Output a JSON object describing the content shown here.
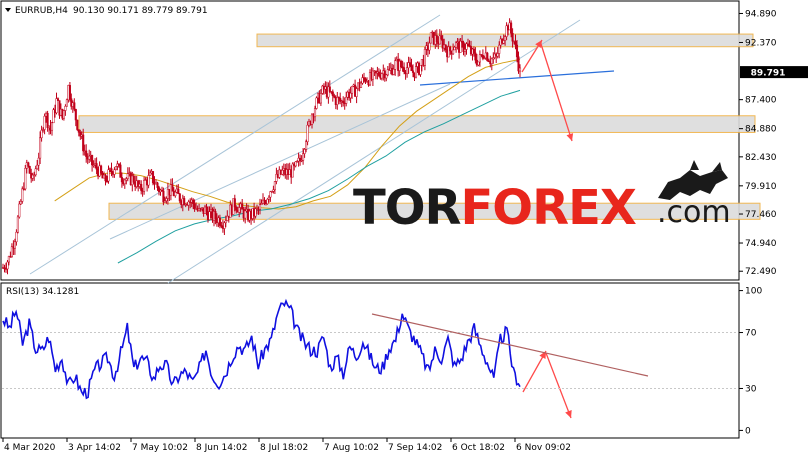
{
  "header": {
    "symbol_label": "EURRUB,H4",
    "ohlc_text": "90.130 90.171 89.779 89.791",
    "collapse_icon": "triangle-down-icon"
  },
  "rsi_header": {
    "label": "RSI(13) 34.1281"
  },
  "watermark": {
    "part1": "TOR",
    "part2": "FOREX",
    "part3": ".com",
    "logo_icon": "bull-bear-icon"
  },
  "colors": {
    "candle": "#c0001a",
    "ma_fast": "#d4a017",
    "ma_slow": "#20a0a0",
    "channel": "#a8c4d8",
    "trend_blue": "#2a6fdb",
    "arrow": "#ff4a4a",
    "zone_fill": "#dcdcdc",
    "zone_border": "#f0b040",
    "rsi_line": "#1010e0",
    "rsi_trend": "#b06060",
    "price_tag_bg": "#000000",
    "price_tag_fg": "#ffffff",
    "watermark_dark": "#1a1a1a",
    "watermark_red": "#e8261c"
  },
  "chart_data": [
    {
      "type": "candlestick",
      "title": "EURRUB,H4",
      "x_labels": [
        "4 Mar 2020",
        "3 Apr 14:02",
        "7 May 10:02",
        "8 Jun 14:02",
        "8 Jul 18:02",
        "7 Aug 10:02",
        "7 Sep 14:02",
        "6 Oct 18:02",
        "6 Nov 09:02"
      ],
      "y_ticks": [
        "94.890",
        "92.370",
        "89.791",
        "87.400",
        "84.880",
        "82.430",
        "79.910",
        "77.460",
        "74.940",
        "72.490"
      ],
      "y_tick_values": [
        94.89,
        92.37,
        89.791,
        87.4,
        84.88,
        82.43,
        79.91,
        77.46,
        74.94,
        72.49
      ],
      "ylim": [
        71.9,
        95.8
      ],
      "current_price": "89.791",
      "close_series": [
        72.8,
        73.6,
        75.5,
        78.5,
        81.8,
        80.3,
        82.6,
        86.3,
        84.8,
        87.3,
        85.8,
        88.5,
        86.3,
        84.3,
        82.5,
        81.8,
        81.3,
        80.3,
        81.0,
        81.8,
        80.7,
        80.5,
        80.5,
        79.5,
        80.3,
        80.7,
        79.8,
        79.1,
        79.5,
        79.2,
        78.8,
        78.7,
        78.4,
        77.6,
        77.8,
        77.3,
        77.1,
        76.8,
        77.6,
        78.4,
        77.8,
        77.3,
        77.4,
        77.8,
        78.5,
        79.6,
        80.5,
        81.1,
        81.0,
        81.3,
        82.1,
        84.2,
        86.2,
        87.4,
        88.3,
        87.9,
        87.4,
        87.2,
        87.9,
        88.1,
        88.7,
        89.3,
        89.2,
        89.6,
        89.9,
        89.8,
        90.5,
        90.3,
        90.2,
        89.8,
        90.1,
        91.2,
        92.8,
        92.6,
        92.3,
        91.5,
        92.2,
        91.9,
        92.1,
        91.3,
        90.7,
        91.6,
        90.9,
        91.0,
        92.8,
        93.9,
        92.5,
        89.79
      ],
      "moving_averages": [
        {
          "name": "",
          "period": 50,
          "values": [
            null,
            null,
            null,
            78.6,
            79.6,
            80.6,
            81.0,
            81.0,
            80.8,
            80.4,
            79.9,
            79.4,
            79.0,
            78.5,
            78.2,
            78.0,
            77.9,
            78.1,
            78.6,
            79.0,
            80.0,
            81.5,
            83.4,
            85.1,
            86.4,
            87.4,
            88.4,
            89.4,
            90.2,
            90.6,
            90.9
          ]
        },
        {
          "name": "",
          "period": 200,
          "values": [
            null,
            null,
            null,
            null,
            null,
            null,
            73.2,
            74.1,
            75.1,
            76.0,
            76.6,
            77.0,
            77.3,
            77.7,
            77.9,
            78.3,
            78.8,
            79.5,
            80.5,
            81.6,
            82.5,
            83.7,
            84.6,
            85.3,
            86.1,
            86.9,
            87.7,
            88.2
          ]
        }
      ],
      "support_resistance_zones": [
        {
          "from": 92.0,
          "to": 93.1
        },
        {
          "from": 84.55,
          "to": 86.0
        },
        {
          "from": 77.0,
          "to": 78.4
        }
      ],
      "trend_channel": "ascending"
    },
    {
      "type": "line",
      "title": "RSI(13) 34.1281",
      "y_ticks": [
        "100",
        "70",
        "30",
        "0"
      ],
      "y_tick_values": [
        100,
        70,
        30,
        0
      ],
      "ylim": [
        -4,
        104
      ],
      "series": [
        {
          "name": "RSI(13)",
          "values": [
            80,
            73,
            86,
            62,
            76,
            58,
            57,
            67,
            44,
            52,
            32,
            39,
            27,
            28,
            43,
            48,
            52,
            39,
            55,
            73,
            44,
            52,
            49,
            37,
            47,
            46,
            32,
            40,
            42,
            34,
            44,
            58,
            39,
            34,
            41,
            53,
            61,
            57,
            67,
            47,
            58,
            65,
            84,
            91,
            85,
            71,
            63,
            58,
            57,
            67,
            45,
            52,
            41,
            60,
            53,
            64,
            54,
            44,
            45,
            59,
            65,
            84,
            72,
            64,
            54,
            42,
            57,
            52,
            65,
            46,
            51,
            63,
            73,
            60,
            49,
            36,
            65,
            71,
            41,
            34
          ]
        }
      ],
      "trendline": "descending"
    }
  ]
}
